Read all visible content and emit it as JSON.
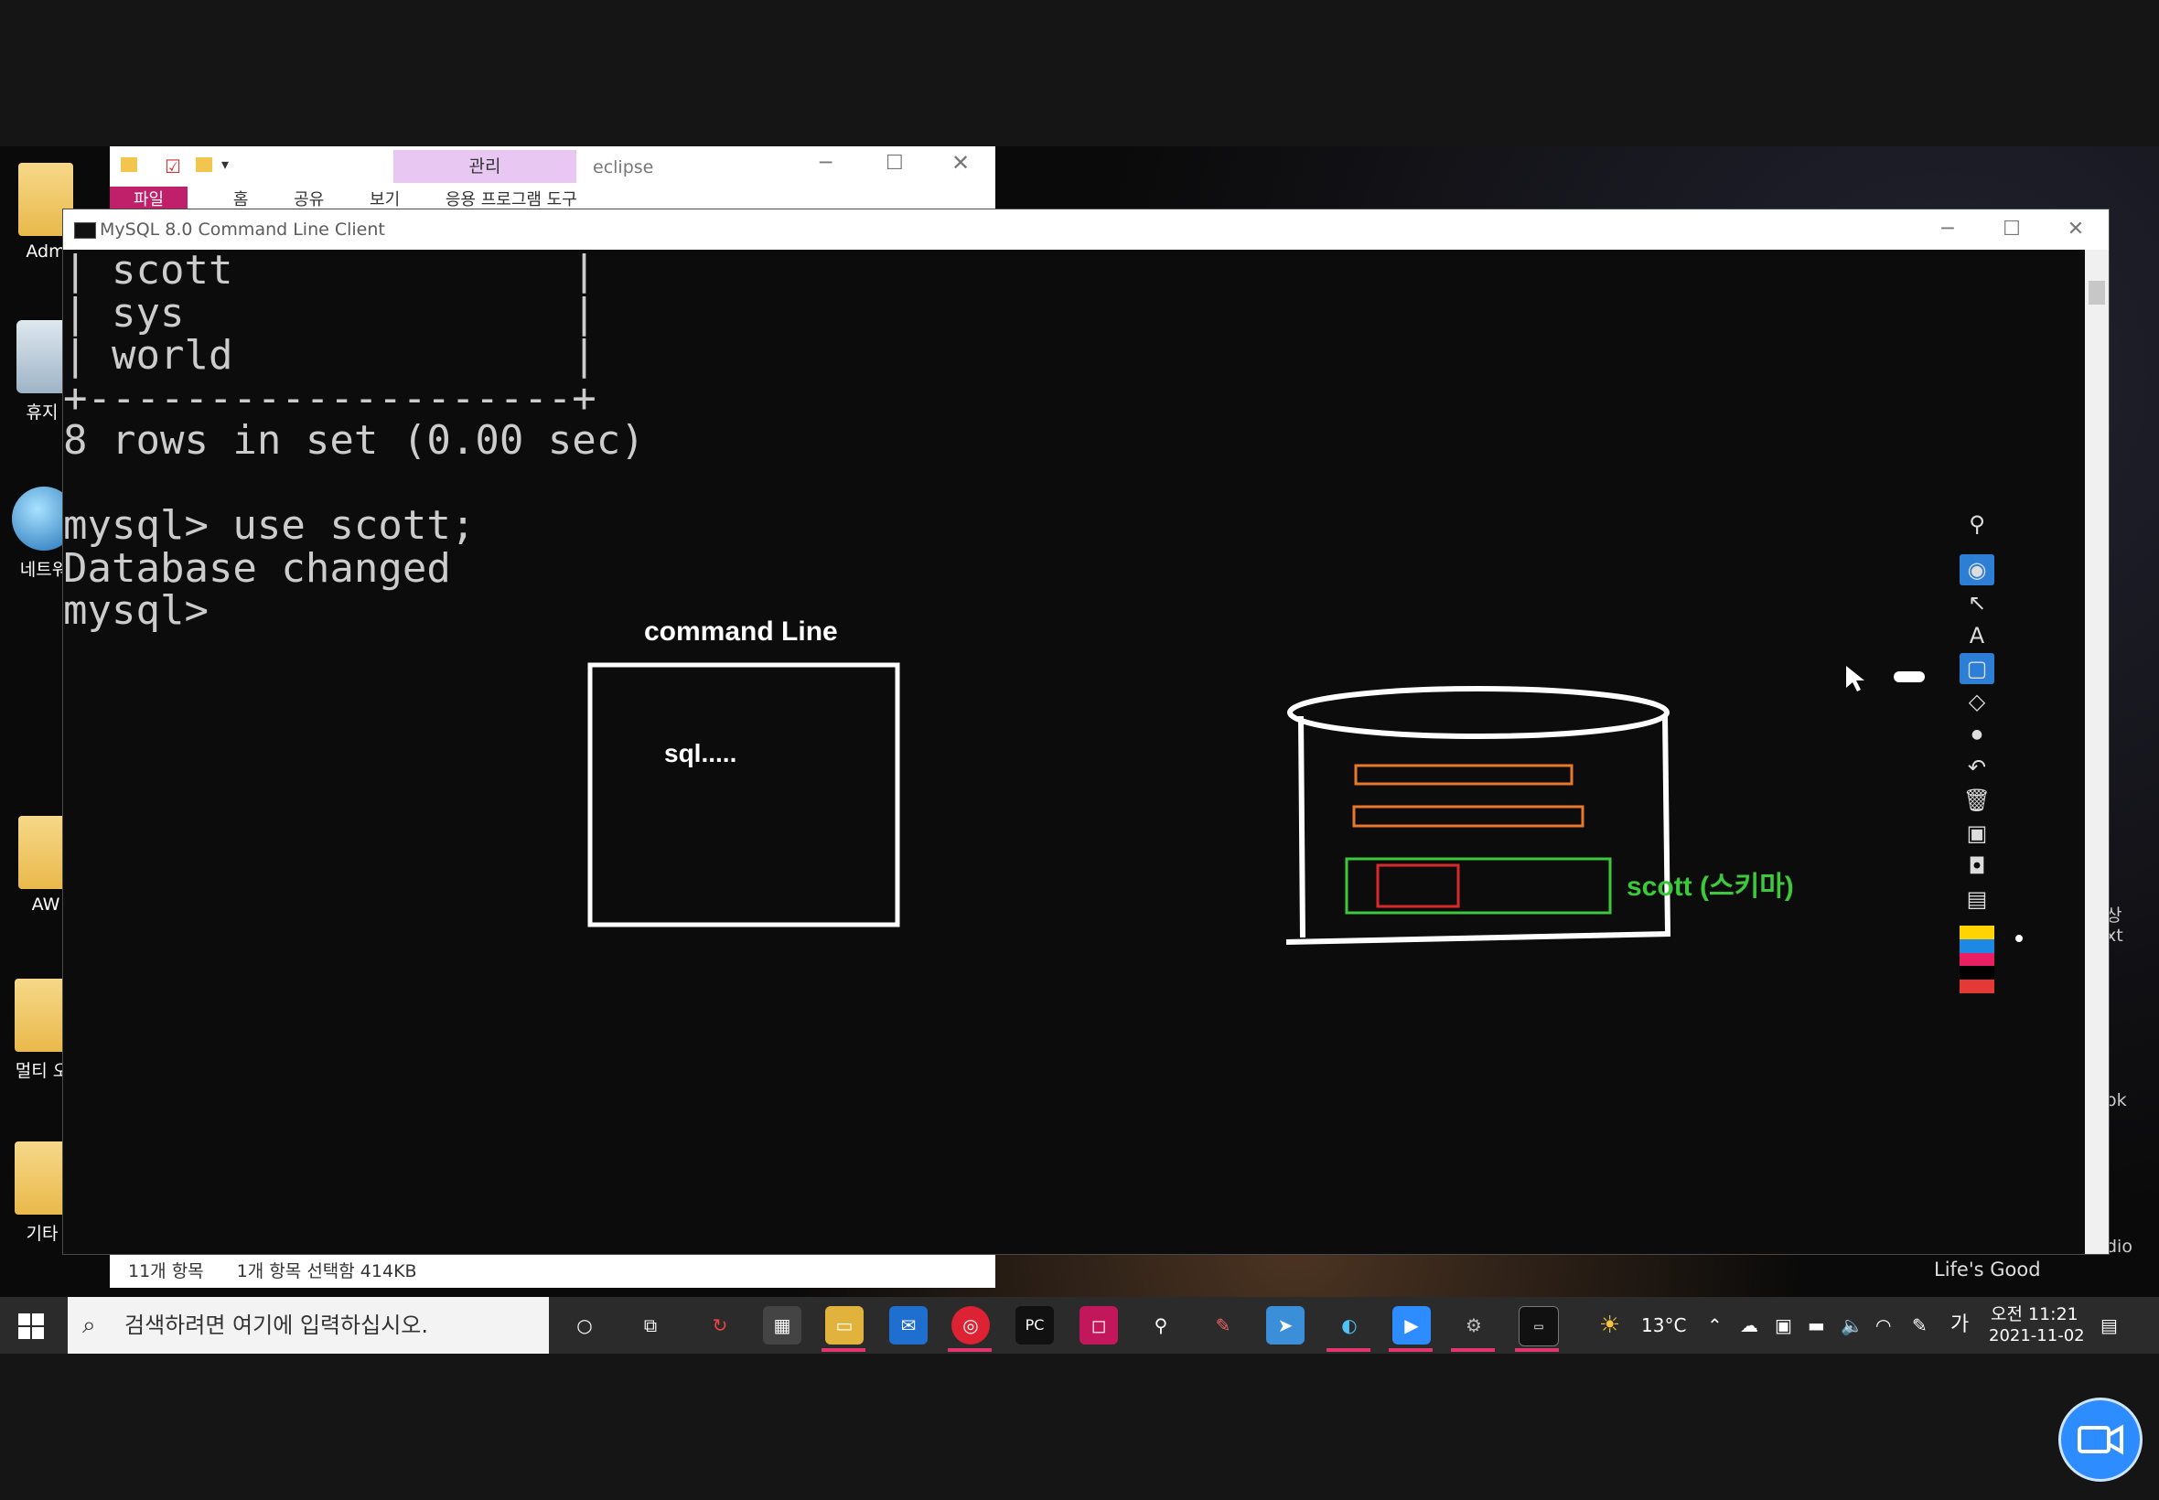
{
  "desktop": {
    "icons": [
      {
        "label": "Adm",
        "kind": "user-folder"
      },
      {
        "label": "휴지",
        "kind": "recycle-bin"
      },
      {
        "label": "네트워",
        "kind": "network"
      },
      {
        "label": "AW",
        "kind": "folder"
      },
      {
        "label": "멀티 오",
        "kind": "folder"
      },
      {
        "label": "기타",
        "kind": "folder"
      }
    ],
    "right_edge_labels": [
      "상",
      "xt",
      "ok",
      "dio"
    ],
    "wallpaper_text": "Life's Good"
  },
  "explorer": {
    "title": "eclipse",
    "manage_tab": "관리",
    "context_tab": "응용 프로그램 도구",
    "ribbon_tabs": [
      "파일",
      "홈",
      "공유",
      "보기"
    ],
    "status_items": "11개 항목",
    "status_selection": "1개 항목 선택함 414KB"
  },
  "console": {
    "title": "MySQL 8.0 Command Line Client",
    "lines": [
      "| scott              |",
      "| sys                |",
      "| world              |",
      "+--------------------+",
      "8 rows in set (0.00 sec)",
      "",
      "mysql> use scott;",
      "Database changed",
      "mysql>"
    ]
  },
  "annotation": {
    "command_line_label": "command Line",
    "sql_label": "sql.....",
    "schema_label": "scott (스키마)",
    "colors": {
      "white": "#ffffff",
      "orange": "#e8782c",
      "green": "#3cc93c",
      "red": "#d62a2a"
    }
  },
  "annotation_toolbar": {
    "tools": [
      "pin-icon",
      "eye-icon",
      "pointer-icon",
      "text-icon",
      "rectangle-icon",
      "eraser-icon",
      "dot-icon",
      "undo-icon",
      "trash-icon",
      "presentation-icon",
      "camera-icon",
      "clipboard-icon"
    ],
    "active_tools": [
      "eye-icon",
      "rectangle-icon"
    ],
    "palette": [
      "#ffd400",
      "#1e88e5",
      "#e91e63",
      "#000000",
      "#e53935"
    ]
  },
  "taskbar": {
    "search_placeholder": "검색하려면 여기에 입력하십시오.",
    "apps": [
      "cortana",
      "task-view",
      "app-red-sync",
      "store",
      "file-explorer",
      "mail",
      "chrome",
      "pycharm",
      "app-red-square",
      "app-pin",
      "app-pencil",
      "app-blue",
      "app-swirl",
      "zoom",
      "app-gear",
      "mysql-console"
    ],
    "weather": "13°C",
    "ime": "가",
    "time": "오전 11:21",
    "date": "2021-11-02"
  }
}
